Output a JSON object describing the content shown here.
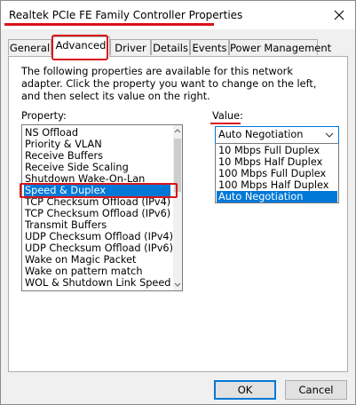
{
  "window": {
    "title": "Realtek PCIe FE Family Controller Properties",
    "close_label": "✕"
  },
  "tabs": [
    {
      "label": "General"
    },
    {
      "label": "Advanced"
    },
    {
      "label": "Driver"
    },
    {
      "label": "Details"
    },
    {
      "label": "Events"
    },
    {
      "label": "Power Management"
    }
  ],
  "active_tab": "Advanced",
  "panel": {
    "description": "The following properties are available for this network adapter. Click the property you want to change on the left, and then select its value on the right.",
    "property_label": "Property:",
    "value_label": "Value:"
  },
  "properties": [
    {
      "label": "NS Offload"
    },
    {
      "label": "Priority & VLAN"
    },
    {
      "label": "Receive Buffers"
    },
    {
      "label": "Receive Side Scaling"
    },
    {
      "label": "Shutdown Wake-On-Lan"
    },
    {
      "label": "Speed & Duplex"
    },
    {
      "label": "TCP Checksum Offload (IPv4)"
    },
    {
      "label": "TCP Checksum Offload (IPv6)"
    },
    {
      "label": "Transmit Buffers"
    },
    {
      "label": "UDP Checksum Offload (IPv4)"
    },
    {
      "label": "UDP Checksum Offload (IPv6)"
    },
    {
      "label": "Wake on Magic Packet"
    },
    {
      "label": "Wake on pattern match"
    },
    {
      "label": "WOL & Shutdown Link Speed"
    }
  ],
  "selected_property": "Speed & Duplex",
  "value": {
    "selected": "Auto Negotiation",
    "options": [
      {
        "label": "10 Mbps Full Duplex"
      },
      {
        "label": "10 Mbps Half Duplex"
      },
      {
        "label": "100 Mbps Full Duplex"
      },
      {
        "label": "100 Mbps Half Duplex"
      },
      {
        "label": "Auto Negotiation"
      }
    ]
  },
  "buttons": {
    "ok": "OK",
    "cancel": "Cancel"
  },
  "colors": {
    "selection": "#0078d7",
    "annotation": "#d9141b",
    "dialog_bg": "#f0f0f0"
  },
  "icons": {
    "close": "close-icon",
    "dropdown": "chevron-down-icon",
    "scroll_up": "scroll-up-arrow-icon",
    "scroll_down": "scroll-down-arrow-icon"
  }
}
